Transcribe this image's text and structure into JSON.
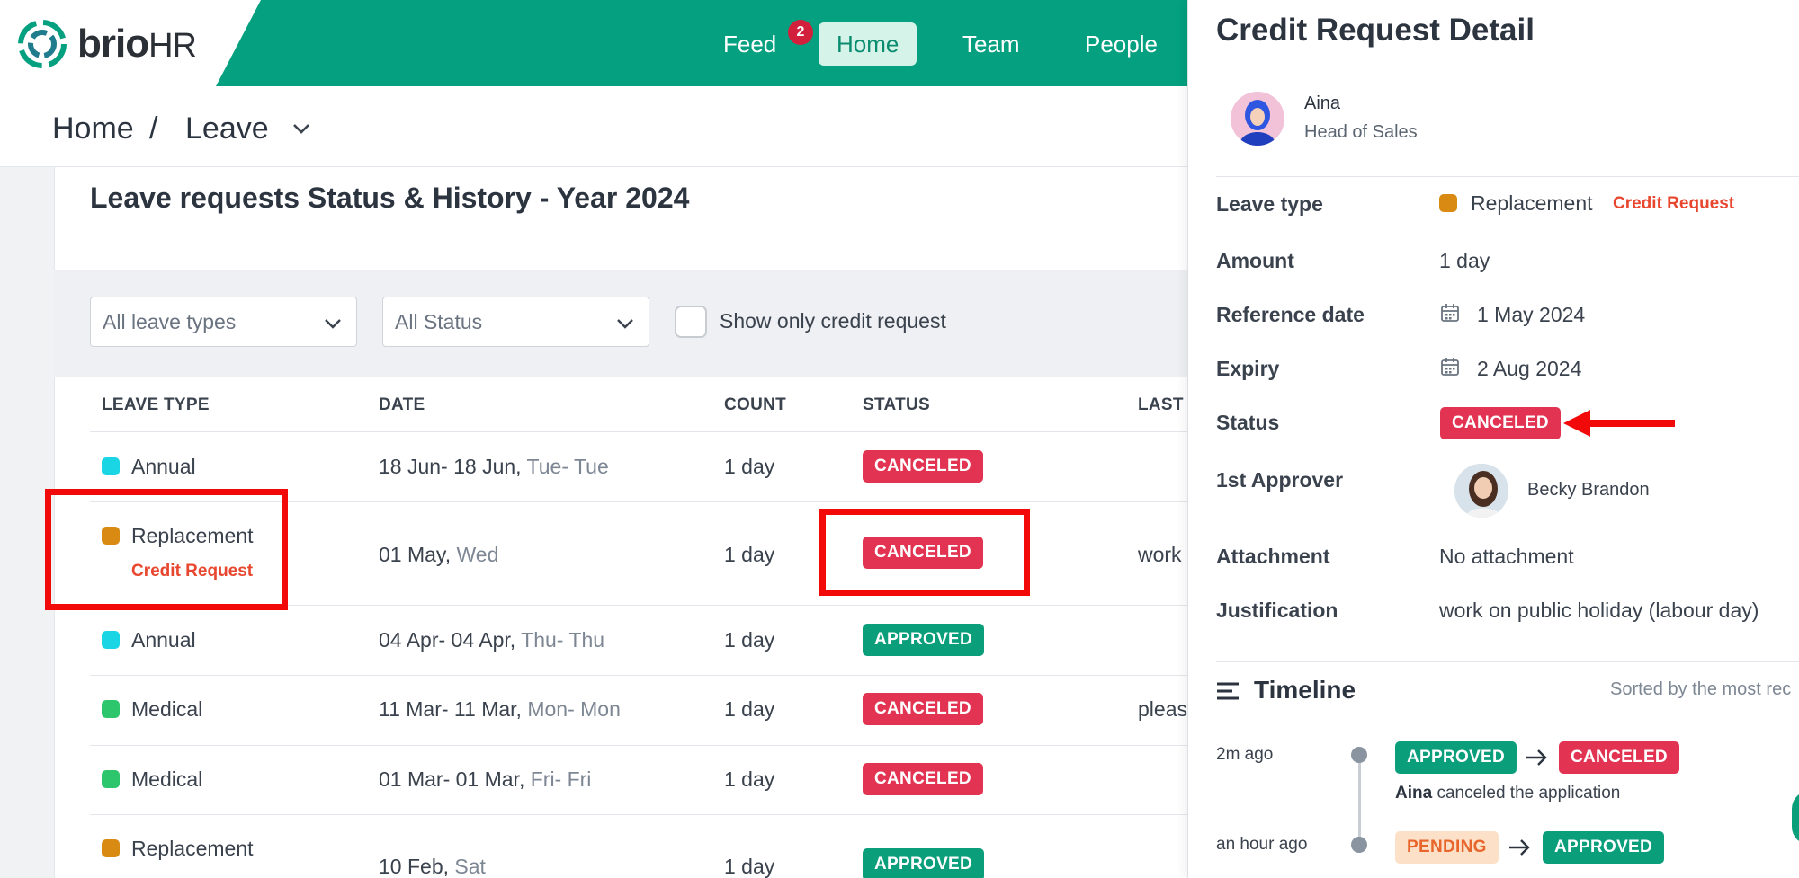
{
  "header": {
    "logo": {
      "brand": "brio",
      "suffix": "HR"
    },
    "nav": [
      {
        "label": "Feed",
        "badge": "2"
      },
      {
        "label": "Home",
        "active": true
      },
      {
        "label": "Team"
      },
      {
        "label": "People"
      }
    ]
  },
  "breadcrumb": {
    "home": "Home",
    "sep": "/",
    "current": "Leave"
  },
  "main": {
    "title": "Leave requests Status & History - Year 2024",
    "filters": {
      "leave_types": "All leave types",
      "status": "All Status",
      "credit_only": "Show only credit request",
      "credit_only_checked": false
    },
    "columns": [
      "LEAVE TYPE",
      "DATE",
      "COUNT",
      "STATUS",
      "LAST"
    ],
    "rows": [
      {
        "type": "Annual",
        "color": "#1ad6e4",
        "date": "18 Jun- 18 Jun,",
        "days": "Tue- Tue",
        "count": "1 day",
        "status": "CANCELED",
        "note": ""
      },
      {
        "type": "Replacement",
        "color": "#d88a12",
        "sub": "Credit Request",
        "date": "01 May,",
        "days": "Wed",
        "count": "1 day",
        "status": "CANCELED",
        "note": "work"
      },
      {
        "type": "Annual",
        "color": "#1ad6e4",
        "date": "04 Apr- 04 Apr,",
        "days": "Thu- Thu",
        "count": "1 day",
        "status": "APPROVED",
        "note": ""
      },
      {
        "type": "Medical",
        "color": "#2ec66c",
        "date": "11 Mar- 11 Mar,",
        "days": "Mon- Mon",
        "count": "1 day",
        "status": "CANCELED",
        "note": "pleas"
      },
      {
        "type": "Medical",
        "color": "#2ec66c",
        "date": "01 Mar- 01 Mar,",
        "days": "Fri- Fri",
        "count": "1 day",
        "status": "CANCELED",
        "note": ""
      },
      {
        "type": "Replacement",
        "color": "#d88a12",
        "date": "10 Feb,",
        "days": "Sat",
        "count": "1 day",
        "status": "APPROVED",
        "note": ""
      }
    ]
  },
  "panel": {
    "title": "Credit Request Detail",
    "employee": {
      "name": "Aina",
      "role": "Head of Sales"
    },
    "fields": {
      "leave_type_label": "Leave type",
      "leave_type": "Replacement",
      "leave_type_color": "#d88a12",
      "credit_tag": "Credit Request",
      "amount_label": "Amount",
      "amount": "1 day",
      "reference_label": "Reference date",
      "reference": "1 May 2024",
      "expiry_label": "Expiry",
      "expiry": "2 Aug 2024",
      "status_label": "Status",
      "status": "CANCELED",
      "approver_label": "1st Approver",
      "approver": "Becky Brandon",
      "attachment_label": "Attachment",
      "attachment": "No attachment",
      "justification_label": "Justification",
      "justification": "work on public holiday (labour day)"
    },
    "timeline": {
      "title": "Timeline",
      "sort": "Sorted by the most rec",
      "events": [
        {
          "time": "2m ago",
          "from": "APPROVED",
          "to": "CANCELED",
          "actor": "Aina",
          "text": "canceled the application"
        },
        {
          "time": "an hour ago",
          "from": "PENDING",
          "to": "APPROVED"
        }
      ]
    }
  },
  "colors": {
    "brand_green": "#04a07f",
    "canceled": "#e23452",
    "approved": "#0a9e7b",
    "pending_bg": "#fde0c8",
    "credit_red": "#e8472f",
    "highlight": "#f20a0a"
  }
}
